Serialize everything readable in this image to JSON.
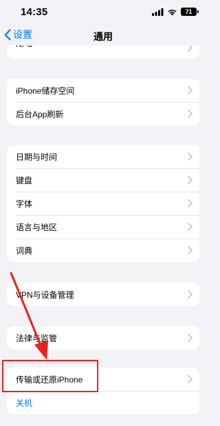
{
  "status_bar": {
    "time": "14:35",
    "battery": "71"
  },
  "nav": {
    "back_label": "设置",
    "title": "通用"
  },
  "groups": [
    {
      "items": [
        {
          "label": "NFC"
        }
      ]
    },
    {
      "items": [
        {
          "label": "iPhone储存空间"
        },
        {
          "label": "后台App刷新"
        }
      ]
    },
    {
      "items": [
        {
          "label": "日期与时间"
        },
        {
          "label": "键盘"
        },
        {
          "label": "字体"
        },
        {
          "label": "语言与地区"
        },
        {
          "label": "词典"
        }
      ]
    },
    {
      "items": [
        {
          "label": "VPN与设备管理"
        }
      ]
    },
    {
      "items": [
        {
          "label": "法律与监管"
        }
      ]
    },
    {
      "items": [
        {
          "label": "传输或还原iPhone"
        },
        {
          "label": "关机"
        }
      ]
    }
  ],
  "annotation": {
    "arrow_color": "#e8231f",
    "highlight_color": "#e8231f"
  }
}
